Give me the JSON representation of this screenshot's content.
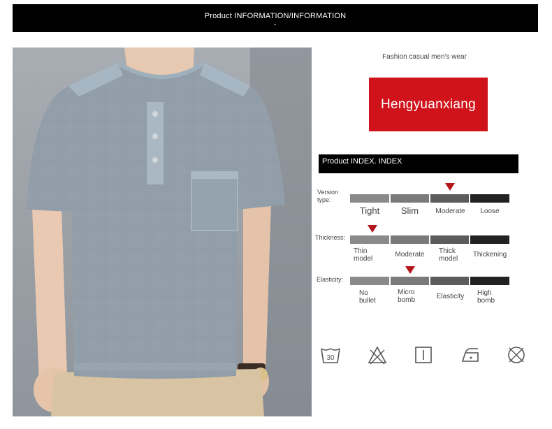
{
  "header": {
    "title": "Product INFORMATION/INFORMATION"
  },
  "product": {
    "subtitle": "Fashion casual men's wear",
    "brand": "Hengyuanxiang",
    "brand_color": "#d0131b"
  },
  "index_header": "Product INDEX. INDEX",
  "metrics": [
    {
      "label": "Version type:",
      "options": [
        "Tight",
        "Slim",
        "Moderate",
        "Loose"
      ],
      "selected": "Moderate"
    },
    {
      "label": "Thickness:",
      "options": [
        "Thin model",
        "Moderate",
        "Thick model",
        "Thickening"
      ],
      "selected": "Thin model"
    },
    {
      "label": "Elasticity:",
      "options": [
        "No bullet",
        "Micro bomb",
        "Elasticity",
        "High bomb"
      ],
      "selected": "Micro bomb"
    }
  ],
  "scale_colors": [
    "#8a8a8a",
    "#7a7a7a",
    "#5c5c5c",
    "#222222"
  ],
  "marker_color": "#b3161b",
  "care_icons": [
    "wash-30-icon",
    "no-bleach-icon",
    "tumble-dry-icon",
    "iron-icon",
    "no-dry-clean-icon"
  ]
}
